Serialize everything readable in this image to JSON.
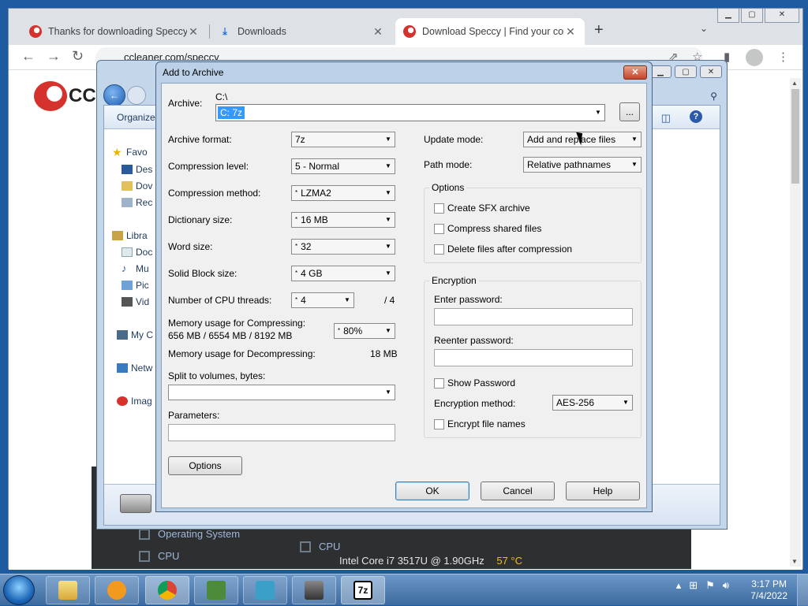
{
  "browser": {
    "tabs": [
      {
        "title": "Thanks for downloading Speccy",
        "active": false
      },
      {
        "title": "Downloads",
        "active": false
      },
      {
        "title": "Download Speccy | Find your cor",
        "active": true
      }
    ],
    "url": "ccleaner.com/speccy",
    "logo_text": "CCl"
  },
  "explorer": {
    "organize": "Organize",
    "nav": {
      "favorites": "Favo",
      "desktop": "Des",
      "downloads": "Dov",
      "recent": "Rec",
      "libraries": "Libra",
      "documents": "Doc",
      "music": "Mu",
      "pictures": "Pic",
      "videos": "Vid",
      "computer": "My C",
      "network": "Netw",
      "imag": "Imag"
    }
  },
  "speccy": {
    "os_label": "Operating System",
    "cpu_label": "CPU",
    "cpu_label2": "CPU",
    "cpu_info": "Intel Core i7 3517U @ 1.90GHz",
    "cpu_temp": "57 °C"
  },
  "dialog": {
    "title": "Add to Archive",
    "archive_label": "Archive:",
    "archive_path": "C:\\",
    "archive_value": "C:  7z",
    "browse_label": "...",
    "left": {
      "archive_format": {
        "label": "Archive format:",
        "value": "7z"
      },
      "compression_level": {
        "label": "Compression level:",
        "value": "5 - Normal"
      },
      "compression_method": {
        "label": "Compression method:",
        "value": "LZMA2"
      },
      "dictionary_size": {
        "label": "Dictionary size:",
        "value": "16 MB"
      },
      "word_size": {
        "label": "Word size:",
        "value": "32"
      },
      "solid_block": {
        "label": "Solid Block size:",
        "value": "4 GB"
      },
      "cpu_threads": {
        "label": "Number of CPU threads:",
        "value": "4",
        "total": "/ 4"
      },
      "mem_compress": {
        "label": "Memory usage for Compressing:",
        "detail": "656 MB / 6554 MB / 8192 MB",
        "value": "80%"
      },
      "mem_decompress": {
        "label": "Memory usage for Decompressing:",
        "value": "18 MB"
      },
      "split_label": "Split to volumes, bytes:",
      "params_label": "Parameters:"
    },
    "right": {
      "update_mode": {
        "label": "Update mode:",
        "value": "Add and replace files"
      },
      "path_mode": {
        "label": "Path mode:",
        "value": "Relative pathnames"
      },
      "options_group": "Options",
      "create_sfx": "Create SFX archive",
      "compress_shared": "Compress shared files",
      "delete_after": "Delete files after compression",
      "encryption_group": "Encryption",
      "enter_password": "Enter password:",
      "reenter_password": "Reenter password:",
      "show_password": "Show Password",
      "encryption_method": {
        "label": "Encryption method:",
        "value": "AES-256"
      },
      "encrypt_names": "Encrypt file names"
    },
    "buttons": {
      "options": "Options",
      "ok": "OK",
      "cancel": "Cancel",
      "help": "Help"
    }
  },
  "taskbar": {
    "time": "3:17 PM",
    "date": "7/4/2022",
    "items": [
      "explorer",
      "media-player",
      "chrome",
      "network-tool",
      "installer",
      "archive-tool",
      "7zip"
    ]
  }
}
